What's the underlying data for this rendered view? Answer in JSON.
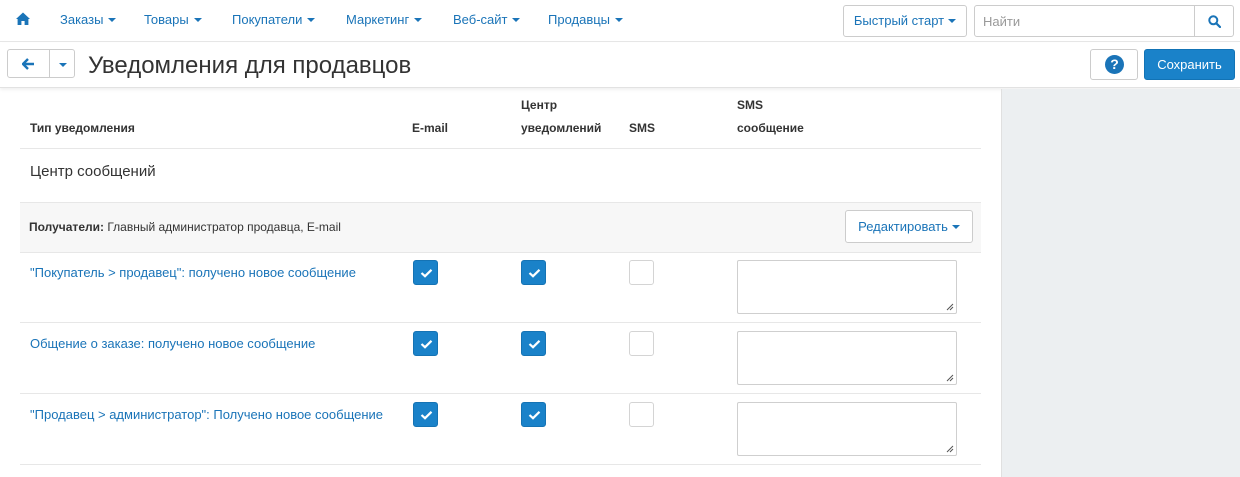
{
  "nav": {
    "items": [
      {
        "label": "Заказы"
      },
      {
        "label": "Товары"
      },
      {
        "label": "Покупатели"
      },
      {
        "label": "Маркетинг"
      },
      {
        "label": "Веб-сайт"
      },
      {
        "label": "Продавцы"
      }
    ],
    "quick_start_label": "Быстрый старт",
    "search_placeholder": "Найти"
  },
  "header": {
    "title": "Уведомления для продавцов",
    "save_label": "Сохранить",
    "help_glyph": "?"
  },
  "table": {
    "columns": {
      "type": "Тип уведомления",
      "email": "E-mail",
      "center_l1": "Центр",
      "center_l2": "уведомлений",
      "sms": "SMS",
      "sms_msg_l1": "SMS",
      "sms_msg_l2": "сообщение"
    },
    "section_title": "Центр сообщений",
    "recipients": {
      "label": "Получатели:",
      "value": "Главный администратор продавца, E-mail",
      "edit_label": "Редактировать"
    },
    "rows": [
      {
        "label": "\"Покупатель > продавец\": получено новое сообщение",
        "email": true,
        "center": true,
        "sms": false,
        "sms_text": ""
      },
      {
        "label": "Общение о заказе: получено новое сообщение",
        "email": true,
        "center": true,
        "sms": false,
        "sms_text": ""
      },
      {
        "label": "\"Продавец > администратор\": Получено новое сообщение",
        "email": true,
        "center": true,
        "sms": false,
        "sms_text": ""
      }
    ]
  },
  "icons": {
    "home": "home-icon",
    "search": "search-icon",
    "back": "arrow-left-icon",
    "help": "question-circle-icon",
    "checkbox_checked": "check-icon",
    "resize": "resize-grip-icon"
  },
  "colors": {
    "link": "#1a74b8",
    "primary_button": "#1a82c9",
    "sidebar_bg": "#eceff1",
    "recipients_bg": "#f7f7f7"
  }
}
